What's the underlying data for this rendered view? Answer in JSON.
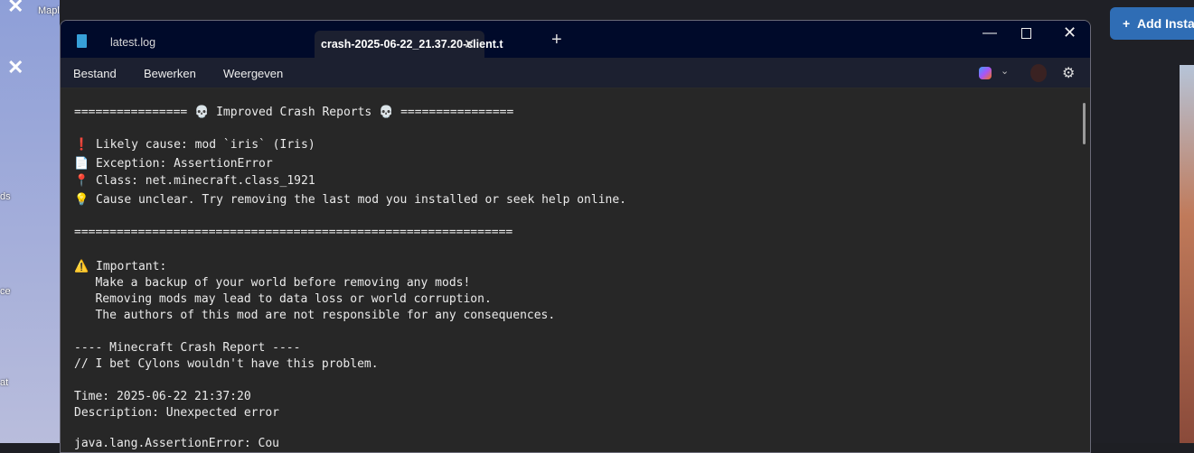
{
  "desktop": {
    "label_top": "Maple",
    "labels": [
      "ds",
      "ce",
      "at"
    ]
  },
  "background_app": {
    "add_button": "Add Insta"
  },
  "window": {
    "tabs": [
      {
        "label": "latest.log"
      },
      {
        "label": "crash-2025-06-22_21.37.20-client.t",
        "active": true
      }
    ],
    "new_tab": "+",
    "menu": [
      "Bestand",
      "Bewerken",
      "Weergeven"
    ],
    "lines": [
      "================ 💀 Improved Crash Reports 💀 ================",
      "",
      "❗ Likely cause: mod `iris` (Iris)",
      "📄 Exception: AssertionError",
      "📍 Class: net.minecraft.class_1921",
      "💡 Cause unclear. Try removing the last mod you installed or seek help online.",
      "",
      "==============================================================",
      "",
      "",
      "⚠️ Important:",
      "   Make a backup of your world before removing any mods!",
      "   Removing mods may lead to data loss or world corruption.",
      "   The authors of this mod are not responsible for any consequences.",
      "",
      "---- Minecraft Crash Report ----",
      "// I bet Cylons wouldn't have this problem.",
      "",
      "Time: 2025-06-22 21:37:20",
      "Description: Unexpected error",
      "",
      "java.lang.AssertionError: Cou"
    ]
  }
}
